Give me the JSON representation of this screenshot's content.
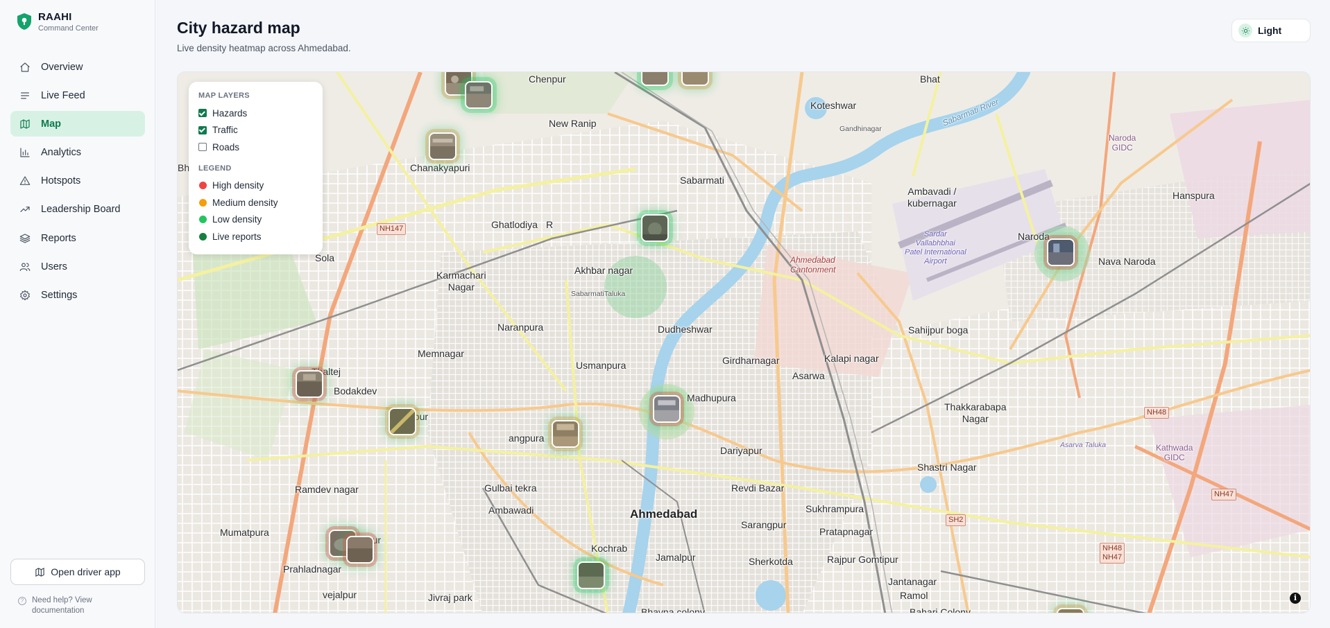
{
  "brand": {
    "name": "RAAHI",
    "subtitle": "Command Center"
  },
  "nav": [
    {
      "label": "Overview",
      "icon": "home-icon",
      "active": false
    },
    {
      "label": "Live Feed",
      "icon": "list-icon",
      "active": false
    },
    {
      "label": "Map",
      "icon": "map-icon",
      "active": true
    },
    {
      "label": "Analytics",
      "icon": "bar-chart-icon",
      "active": false
    },
    {
      "label": "Hotspots",
      "icon": "warning-triangle-icon",
      "active": false
    },
    {
      "label": "Leadership Board",
      "icon": "trending-up-icon",
      "active": false
    },
    {
      "label": "Reports",
      "icon": "layers-icon",
      "active": false
    },
    {
      "label": "Users",
      "icon": "users-icon",
      "active": false
    },
    {
      "label": "Settings",
      "icon": "gear-icon",
      "active": false
    }
  ],
  "driver_app_label": "Open driver app",
  "help_text": "Need help? View documentation",
  "header": {
    "title": "City hazard map",
    "subtitle": "Live density heatmap across Ahmedabad.",
    "theme_label": "Light"
  },
  "layers_panel": {
    "layers_heading": "MAP LAYERS",
    "layers": [
      {
        "label": "Hazards",
        "checked": true
      },
      {
        "label": "Traffic",
        "checked": true
      },
      {
        "label": "Roads",
        "checked": false
      }
    ],
    "legend_heading": "LEGEND",
    "legend": [
      {
        "label": "High density",
        "color": "#ef4444"
      },
      {
        "label": "Medium density",
        "color": "#f59e0b"
      },
      {
        "label": "Low density",
        "color": "#22c55e"
      },
      {
        "label": "Live reports",
        "color": "#15803d"
      }
    ]
  },
  "map_labels": {
    "chenpur": "Chenpur",
    "bhat": "Bhat",
    "koteshwar": "Koteshwar",
    "gandhinagar": "Gandhinagar",
    "new_ranip": "New Ranip",
    "chanakyapuri": "Chanakyapuri",
    "sabarmati": "Sabarmati",
    "ghatlodiya": "Ghatlodiya",
    "sola": "Sola",
    "karmachari": "Karmachari\nNagar",
    "akhbar": "Akhbar nagar",
    "naranpura": "Naranpura",
    "memnagar": "Memnagar",
    "usmanpura": "Usmanpura",
    "thaltej": "Thaltej",
    "bodakdev": "Bodakdev",
    "dudheshwar": "Dudheshwar",
    "girdharnagar": "Girdharnagar",
    "asarwa": "Asarwa",
    "madhupura": "Madhupura",
    "dariyapur": "Dariyapur",
    "ambavadi_k": "Ambavadi /\nkubernagar",
    "naroda": "Naroda",
    "nava_naroda": "Nava Naroda",
    "hansputa": "Hanspura",
    "sahijpur": "Sahijpur boga",
    "kalapi": "Kalapi nagar",
    "thakkarbapa": "Thakkarabapa\nNagar",
    "shastri": "Shastri Nagar",
    "ramdev": "Ramdev nagar",
    "gulbai": "Gulbai tekra",
    "ambawadi": "Ambawadi",
    "revdi": "Revdi Bazar",
    "sukhrampura": "Sukhrampura",
    "ahmedabad": "Ahmedabad",
    "sarangpur": "Sarangpur",
    "pratapnagar": "Pratapnagar",
    "mumatpura": "Mumatpura",
    "prahladnagar": "Prahladnagar",
    "kochrab": "Kochrab",
    "jamalpur": "Jamalpur",
    "sherkotda": "Sherkotda",
    "rajpur": "Rajpur Gomtipur",
    "jantanagar": "Jantanagar",
    "ramol": "Ramol",
    "vejalpur": "vejalpur",
    "jivraj": "Jivraj park",
    "bhavna": "Bhavna colony",
    "bahari": "Bahari Colony",
    "cantonment": "Ahmedabad\nCantonment",
    "airport": "Sardar\nVallabhbhai\nPatel International\nAirport",
    "naroda_gidc": "Naroda\nGIDC",
    "kathwada": "Kathwada\nGIDC",
    "sabarmati_taluka": "SabarmatiTaluka",
    "asarva_taluka": "Asarva Taluka",
    "apur": "apur",
    "angpura": "angpura",
    "hpur": "hpur",
    "r": "R",
    "bha": "Bha",
    "sabarmati_river": "Sabarmati River",
    "nh147": "NH147",
    "nh48a": "NH48",
    "nh47": "NH47",
    "nh48b": "NH48\nNH47",
    "sh2": "SH2"
  }
}
